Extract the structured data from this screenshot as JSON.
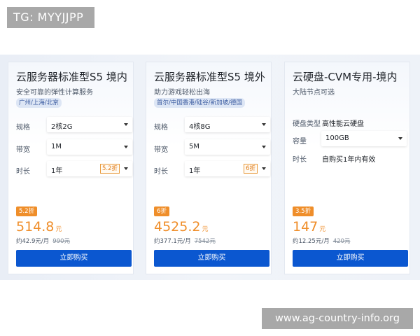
{
  "watermark_top": "TG: MYYJJPP",
  "watermark_bottom": "www.ag-country-info.org",
  "cards": [
    {
      "title": "云服务器标准型S5 境内",
      "subtitle": "安全可靠的弹性计算服务",
      "region": "广州/上海/北京",
      "specs": [
        {
          "label": "规格",
          "value": "2核2G"
        },
        {
          "label": "带宽",
          "value": "1M"
        },
        {
          "label": "时长",
          "value": "1年",
          "discount": "5.2折"
        }
      ],
      "badge": "5.2折",
      "price": "514.8",
      "price_unit": "元",
      "monthly": "约42.9元/月",
      "original": "990元",
      "buy_label": "立即购买"
    },
    {
      "title": "云服务器标准型S5 境外",
      "subtitle": "助力游戏轻松出海",
      "region": "首尔/中国香港/硅谷/新加坡/德国",
      "specs": [
        {
          "label": "规格",
          "value": "4核8G"
        },
        {
          "label": "带宽",
          "value": "5M"
        },
        {
          "label": "时长",
          "value": "1年",
          "discount": "6折"
        }
      ],
      "badge": "6折",
      "price": "4525.2",
      "price_unit": "元",
      "monthly": "约377.1元/月",
      "original": "7542元",
      "buy_label": "立即购买"
    },
    {
      "title": "云硬盘-CVM专用-境内",
      "subtitle": "大陆节点可选",
      "disk_type_label": "硬盘类型",
      "disk_type_value": "高性能云硬盘",
      "capacity_label": "容量",
      "capacity_value": "100GB",
      "duration_label": "时长",
      "duration_value": "自购买1年内有效",
      "badge": "3.5折",
      "price": "147",
      "price_unit": "元",
      "monthly": "约12.25元/月",
      "original": "420元",
      "buy_label": "立即购买"
    }
  ]
}
